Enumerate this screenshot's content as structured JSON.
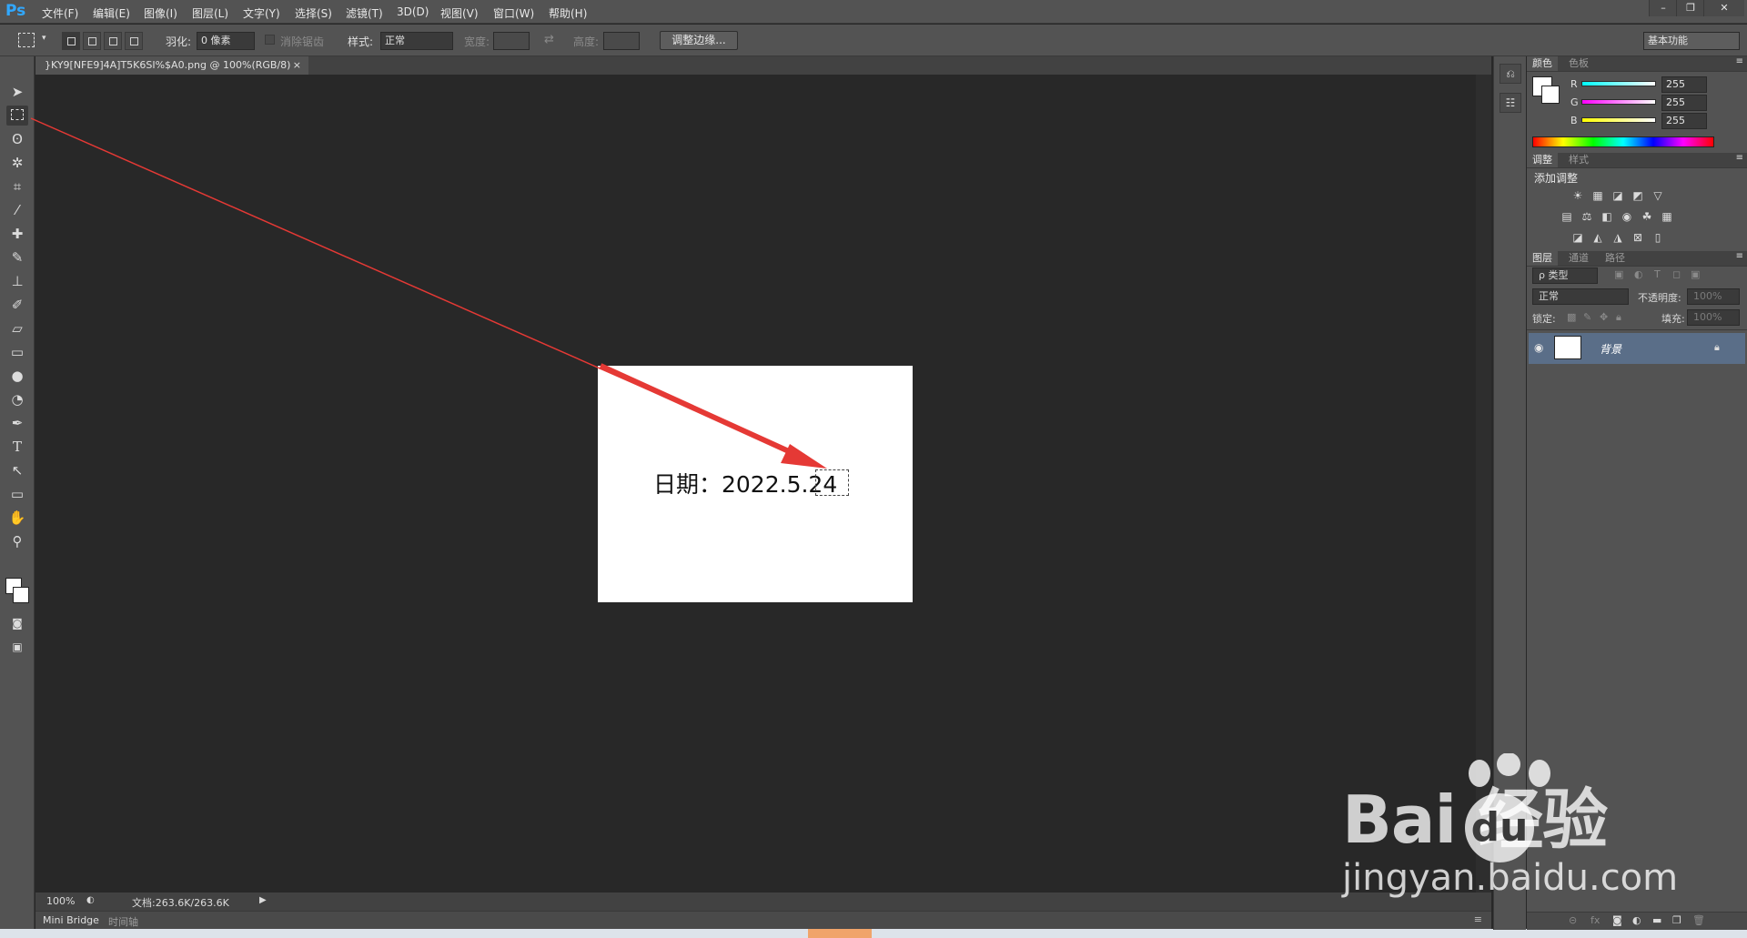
{
  "app": {
    "logo": "Ps"
  },
  "menu": [
    "文件(F)",
    "编辑(E)",
    "图像(I)",
    "图层(L)",
    "文字(Y)",
    "选择(S)",
    "滤镜(T)",
    "3D(D)",
    "视图(V)",
    "窗口(W)",
    "帮助(H)"
  ],
  "window_controls": {
    "minimize": "–",
    "restore": "❐",
    "close": "✕"
  },
  "options": {
    "feather_label": "羽化:",
    "feather_value": "0 像素",
    "antialias_label": "消除锯齿",
    "style_label": "样式:",
    "style_value": "正常",
    "width_label": "宽度:",
    "height_label": "高度:",
    "refine_edge_button": "调整边缘...",
    "workspace": "基本功能"
  },
  "document": {
    "tab_title": "}KY9[NFE9]4A]T5K6SI%$A0.png @ 100%(RGB/8)",
    "tab_close": "×",
    "canvas_text": "日期：2022.5.24"
  },
  "status": {
    "zoom": "100%",
    "doc_info": "文档:263.6K/263.6K"
  },
  "bottom_tabs": [
    "Mini Bridge",
    "时间轴"
  ],
  "color_panel": {
    "tabs": [
      "颜色",
      "色板"
    ],
    "channels": [
      {
        "label": "R",
        "value": "255",
        "color": "#00e0e0"
      },
      {
        "label": "G",
        "value": "255",
        "color": "#e000e0"
      },
      {
        "label": "B",
        "value": "255",
        "color": "#e0e000"
      }
    ]
  },
  "adjust_panel": {
    "tabs": [
      "调整",
      "样式"
    ],
    "title": "添加调整"
  },
  "layers_panel": {
    "tabs": [
      "图层",
      "通道",
      "路径"
    ],
    "filter": "ρ 类型",
    "blend_mode": "正常",
    "opacity_label": "不透明度:",
    "opacity_value": "100%",
    "lock_label": "锁定:",
    "fill_label": "填充:",
    "fill_value": "100%",
    "layer_name": "背景"
  },
  "watermark": {
    "logo": "Bai  经验",
    "logo_du": "du",
    "url": "jingyan.baidu.com"
  },
  "colors": {
    "ui": "#535353",
    "canvas_bg": "#282828",
    "arrow": "#e53935",
    "selected_layer": "#5a6e88"
  }
}
